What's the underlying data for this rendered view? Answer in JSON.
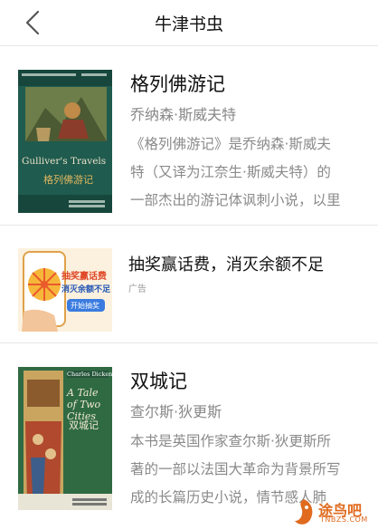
{
  "nav": {
    "title": "牛津书虫"
  },
  "books": [
    {
      "title": "格列佛游记",
      "author": "乔纳森·斯威夫特",
      "desc": [
        "《格列佛游记》是乔纳森·斯威夫",
        "特（又译为江奈生·斯威夫特）的",
        "一部杰出的游记体讽刺小说，以里"
      ],
      "cover": {
        "en": "Gulliver's Travels",
        "zh": "格列佛游记",
        "bg": "#1f5b4e",
        "accent": "#cda24f"
      }
    },
    {
      "title": "双城记",
      "author": "查尔斯·狄更斯",
      "desc": [
        "本书是英国作家查尔斯·狄更斯所",
        "著的一部以法国大革命为背景所写",
        "成的长篇历史小说，情节感人肺"
      ],
      "cover": {
        "en_author": "Charles Dickens",
        "en": "A Tale of Two Cities",
        "zh": "双城记",
        "bg": "#2f6a43"
      }
    }
  ],
  "ad": {
    "title": "抽奖赢话费，消灭余额不足",
    "tag": "广告",
    "banner": {
      "line1": "抽奖赢话费",
      "line2": "消灭余额不足",
      "button": "开始抽奖"
    }
  },
  "watermark": {
    "brand": "途鸟吧",
    "site": "TNBZS.COM"
  },
  "colors": {
    "accent": "#e06a1e",
    "cover1": "#1f5b4e",
    "cover2": "#2f6a43"
  }
}
